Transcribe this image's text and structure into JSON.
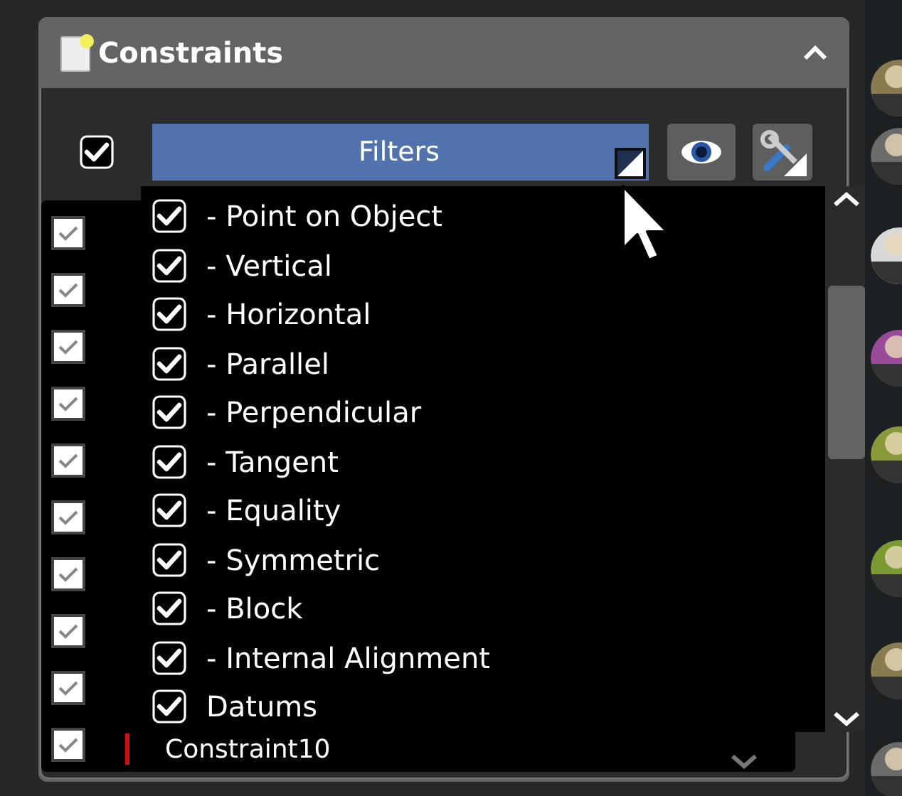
{
  "panel": {
    "title": "Constraints",
    "expanded": true
  },
  "toolbar": {
    "show_all_checked": true,
    "filter_button": "Filters"
  },
  "constraint_list": {
    "rows": [
      {
        "checked": true
      },
      {
        "checked": true
      },
      {
        "checked": true
      },
      {
        "checked": true
      },
      {
        "checked": true
      },
      {
        "checked": true
      },
      {
        "checked": true
      },
      {
        "checked": true
      },
      {
        "checked": true
      },
      {
        "checked": true,
        "label": "Constraint10"
      }
    ]
  },
  "filter_menu": {
    "items": [
      {
        "label": "- Point on Object",
        "checked": true
      },
      {
        "label": "- Vertical",
        "checked": true
      },
      {
        "label": "- Horizontal",
        "checked": true
      },
      {
        "label": "- Parallel",
        "checked": true
      },
      {
        "label": "- Perpendicular",
        "checked": true
      },
      {
        "label": "- Tangent",
        "checked": true
      },
      {
        "label": "- Equality",
        "checked": true
      },
      {
        "label": "- Symmetric",
        "checked": true
      },
      {
        "label": "- Block",
        "checked": true
      },
      {
        "label": "- Internal Alignment",
        "checked": true
      },
      {
        "label": "Datums",
        "checked": true
      }
    ]
  }
}
